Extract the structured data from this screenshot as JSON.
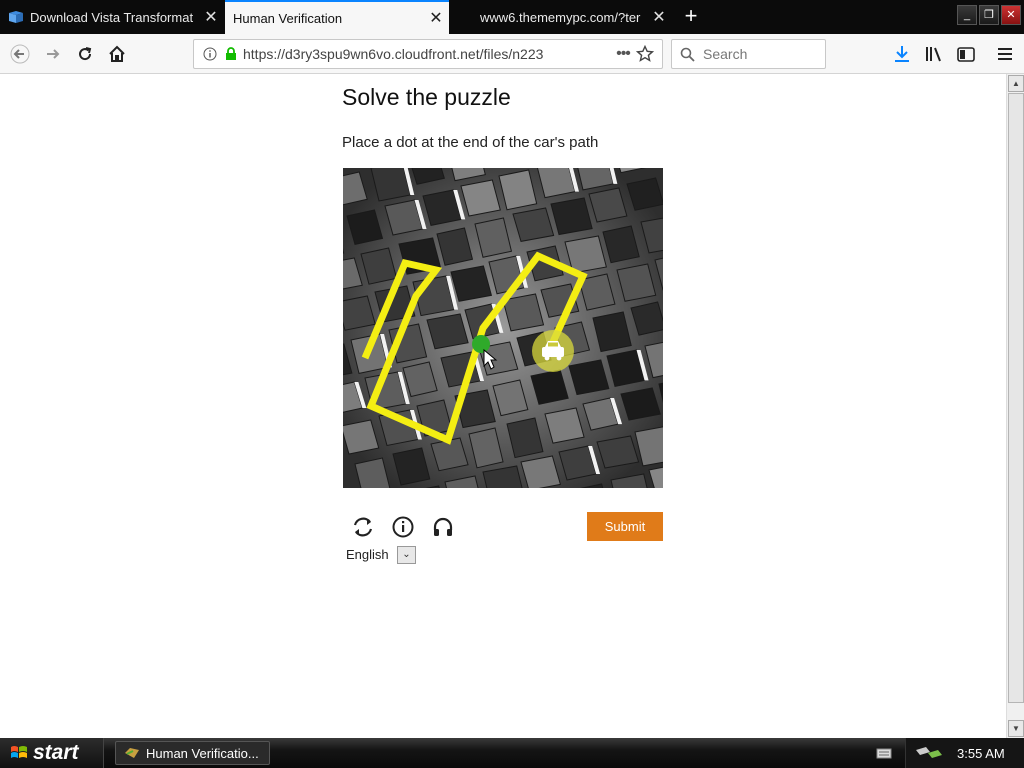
{
  "browser": {
    "tabs": [
      {
        "title": "Download Vista Transformat",
        "active": false
      },
      {
        "title": "Human Verification",
        "active": true
      },
      {
        "title": "www6.thememypc.com/?ter",
        "active": false
      }
    ],
    "url": "https://d3ry3spu9wn6vo.cloudfront.net/files/n223",
    "search_placeholder": "Search"
  },
  "page": {
    "heading": "Solve the puzzle",
    "instruction": "Place a dot at the end of the car's path",
    "submit_label": "Submit",
    "language": "English"
  },
  "taskbar": {
    "start_label": "start",
    "task_title": "Human Verificatio...",
    "clock": "3:55 AM"
  },
  "colors": {
    "submit": "#e07b19",
    "path": "#f4ee13",
    "dot": "#2faa2a",
    "tab_accent": "#0a84ff"
  }
}
